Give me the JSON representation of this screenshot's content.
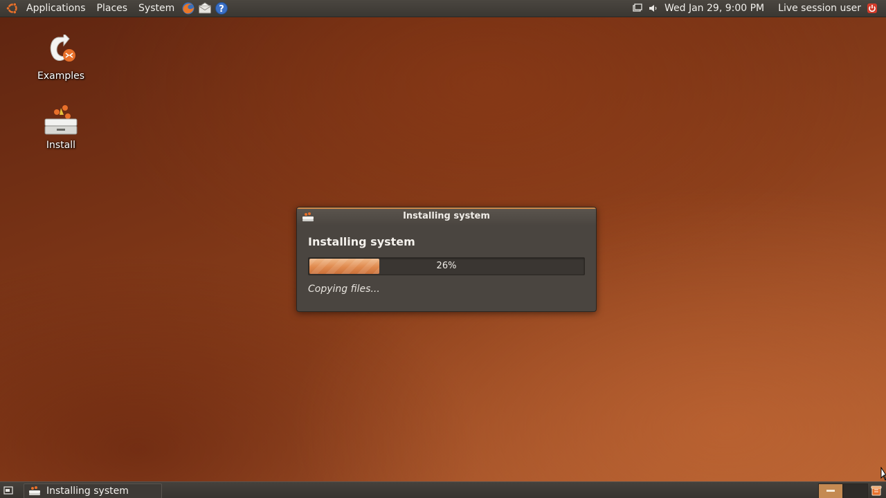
{
  "top_panel": {
    "menus": [
      "Applications",
      "Places",
      "System"
    ],
    "launchers": [
      "firefox-icon",
      "mail-icon",
      "help-icon"
    ],
    "tray": [
      "network-icon",
      "volume-icon"
    ],
    "clock": "Wed Jan 29,  9:00 PM",
    "user": "Live session user"
  },
  "desktop": {
    "icons": [
      {
        "label": "Examples",
        "icon": "examples-icon"
      },
      {
        "label": "Install",
        "icon": "install-icon"
      }
    ]
  },
  "dialog": {
    "title": "Installing system",
    "heading": "Installing system",
    "progress": {
      "value": 26,
      "text": "26%"
    },
    "status": "Copying files..."
  },
  "bottom_panel": {
    "task": "Installing system",
    "workspaces": 2,
    "active_workspace": 1
  },
  "colors": {
    "accent": "#e08a4e",
    "panel": "#3d3a35",
    "dialog_bg": "#4a4540"
  }
}
